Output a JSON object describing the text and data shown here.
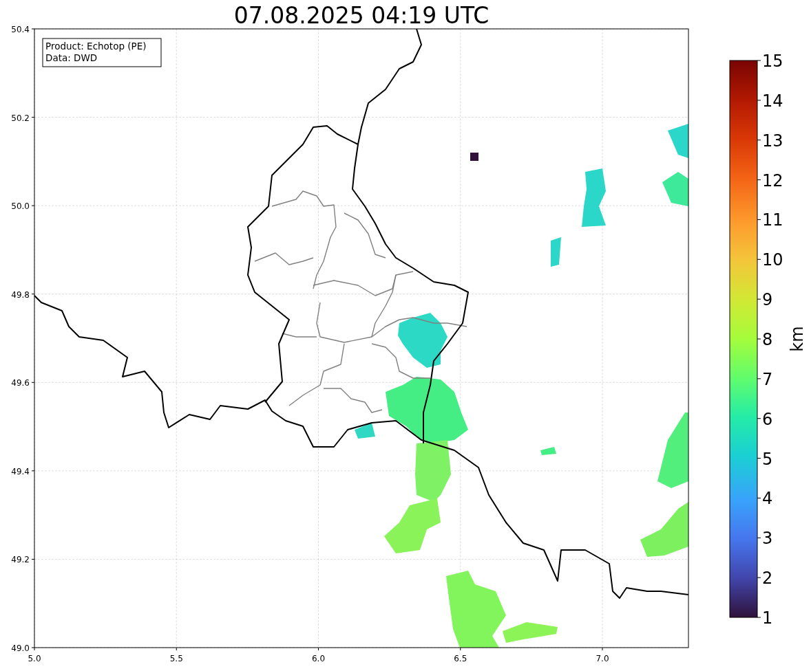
{
  "figure": {
    "title": "07.08.2025 04:19 UTC"
  },
  "map": {
    "info_box": [
      "Product: Echotop (PE)",
      "Data: DWD"
    ],
    "xticks": [
      "5.0",
      "5.5",
      "6.0",
      "6.5",
      "7.0"
    ],
    "yticks": [
      "50.4",
      "50.2",
      "50.0",
      "49.8",
      "49.6",
      "49.4",
      "49.2",
      "49.0"
    ]
  },
  "colorbar": {
    "label": "km",
    "ticks": [
      "15",
      "14",
      "13",
      "12",
      "11",
      "10",
      "9",
      "8",
      "7",
      "6",
      "5",
      "4",
      "3",
      "2",
      "1"
    ]
  }
}
